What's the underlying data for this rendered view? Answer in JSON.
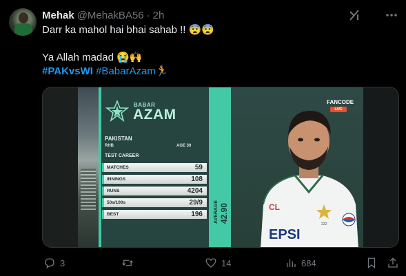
{
  "author": {
    "name": "Mehak",
    "handle": "@MehakBA56",
    "separator": "·",
    "time": "2h"
  },
  "tweet": {
    "line1": "Darr ka mahol hai bhai sahab !! 😨😨",
    "line2": "Ya Allah madad 😭🙌",
    "hashtag1": "#PAKvsWI",
    "hashtag2": "#BabarAzam",
    "hashtag2_suffix": "🏃"
  },
  "graphic": {
    "first_name": "BABAR",
    "last_name": "AZAM",
    "country": "PAKISTAN",
    "batting_style": "RHB",
    "age": "AGE 30",
    "section": "TEST CAREER",
    "stats": [
      {
        "label": "MATCHES",
        "value": "59"
      },
      {
        "label": "INNINGS",
        "value": "108"
      },
      {
        "label": "RUNS",
        "value": "4204"
      },
      {
        "label": "50s/100s",
        "value": "29/9"
      },
      {
        "label": "BEST",
        "value": "196"
      }
    ],
    "average_label": "AVERAGE",
    "average_value": "42.90",
    "broadcaster": "FANCODE",
    "live": "LIVE",
    "shirt_sponsor": "PEPSI",
    "shirt_sponsor_visible": "EPSI",
    "shirt_logo_text": "CL",
    "shirt_number": "222"
  },
  "actions": {
    "replies": "3",
    "retweets": "",
    "likes": "14",
    "views": "684"
  },
  "colors": {
    "accent": "#1d9bf0",
    "teal": "#43c9a6",
    "panel": "#264440",
    "muted": "#71767b"
  }
}
